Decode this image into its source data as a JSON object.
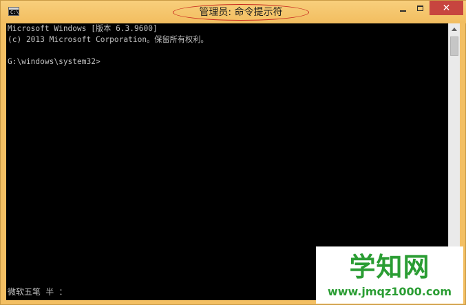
{
  "window": {
    "title": "管理员: 命令提示符",
    "icon": "cmd-icon",
    "icon_text": "C:\\",
    "controls": {
      "minimize_icon": "minimize-icon",
      "maximize_icon": "maximize-icon",
      "close_icon": "close-icon",
      "close_glyph": "✕"
    }
  },
  "console": {
    "lines": [
      "Microsoft Windows [版本 6.3.9600]",
      "(c) 2013 Microsoft Corporation。保留所有权利。",
      "G:\\windows\\system32>"
    ],
    "ime_status": "微软五笔 半 ："
  },
  "watermark": {
    "title": "学知网",
    "url": "www.jmqz1000.com"
  },
  "colors": {
    "titlebar": "#f3bf63",
    "console_bg": "#000000",
    "console_text": "#c0c0c0",
    "close_button": "#c7453f",
    "annotation_oval": "#c9291f",
    "watermark_green": "#2a9d33"
  }
}
